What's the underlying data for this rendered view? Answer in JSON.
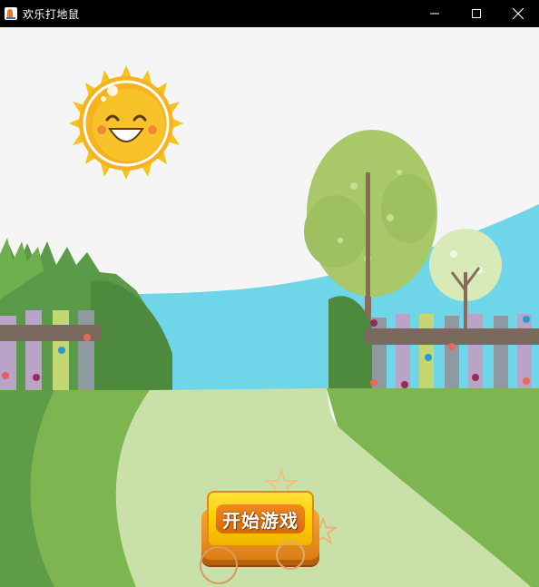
{
  "window": {
    "title": "欢乐打地鼠",
    "controls": {
      "minimize_icon": "minimize-icon",
      "maximize_icon": "maximize-icon",
      "close_icon": "close-icon"
    }
  },
  "main": {
    "start_button_label": "开始游戏"
  },
  "colors": {
    "titlebar": "#000000",
    "sky": "#f5f5f5",
    "hill_light": "#7db650",
    "hill_dark": "#5a9a48",
    "path": "#c9e0a8",
    "lake": "#6fd6ea",
    "sun": "#f5b82a",
    "button_yellow": "#ffd21a",
    "button_orange": "#e8801a"
  }
}
